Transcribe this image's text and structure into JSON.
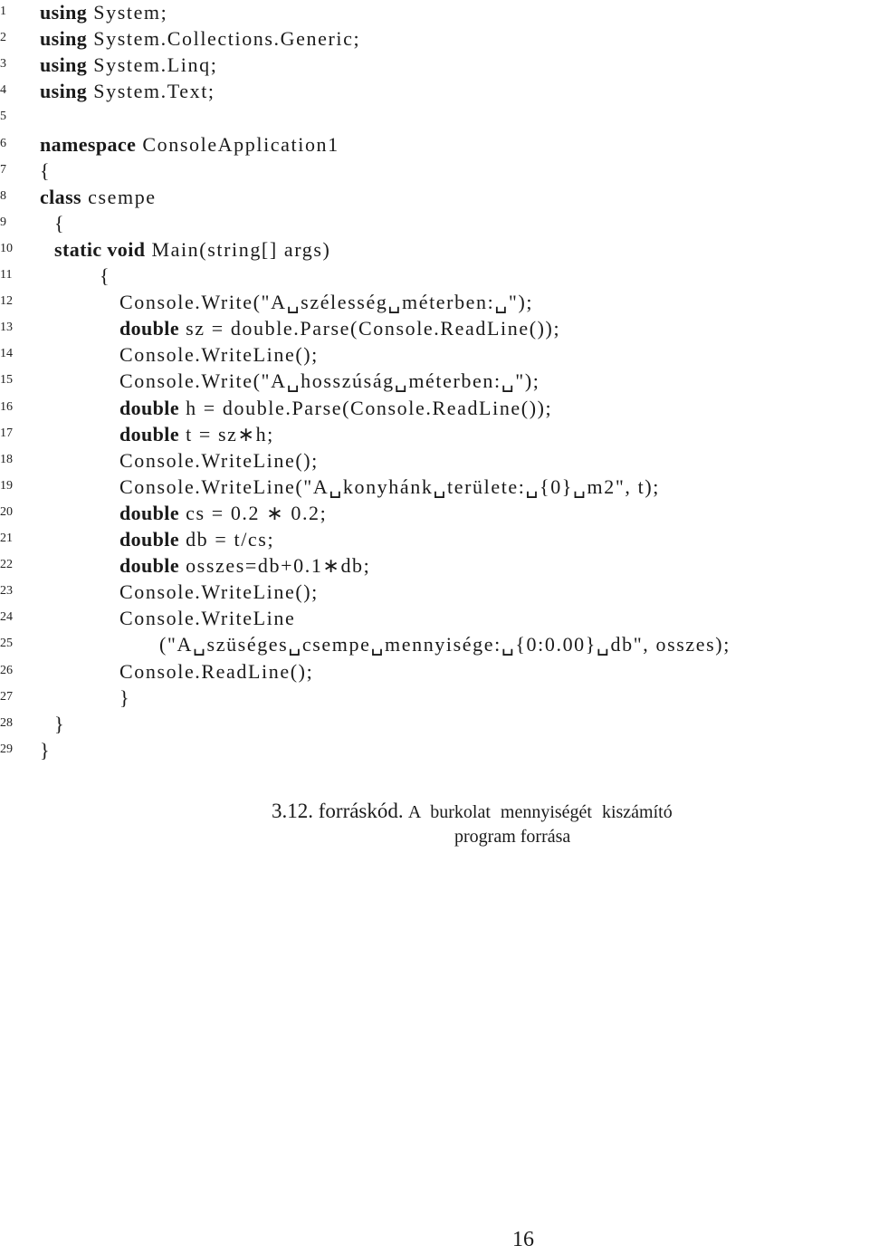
{
  "listing": {
    "lines": [
      {
        "n": "1",
        "indent": 0,
        "kw": "using",
        "rest": " System;"
      },
      {
        "n": "2",
        "indent": 0,
        "kw": "using",
        "rest": " System.Collections.Generic;"
      },
      {
        "n": "3",
        "indent": 0,
        "kw": "using",
        "rest": " System.Linq;"
      },
      {
        "n": "4",
        "indent": 0,
        "kw": "using",
        "rest": " System.Text;"
      },
      {
        "n": "5",
        "indent": 0,
        "kw": "",
        "rest": ""
      },
      {
        "n": "6",
        "indent": 0,
        "kw": "namespace",
        "rest": " ConsoleApplication1"
      },
      {
        "n": "7",
        "indent": 0,
        "kw": "",
        "rest": "{"
      },
      {
        "n": "8",
        "indent": 0,
        "kw": "class",
        "rest": " csempe"
      },
      {
        "n": "9",
        "indent": 1,
        "kw": "",
        "rest": "{"
      },
      {
        "n": "10",
        "indent": 1,
        "kw": "static void",
        "rest": " Main(string[] args)"
      },
      {
        "n": "11",
        "indent": 2,
        "kw": "",
        "rest": "{"
      },
      {
        "n": "12",
        "indent": 3,
        "kw": "",
        "rest": "Console.Write(\"A␣szélesség␣méterben:␣\");"
      },
      {
        "n": "13",
        "indent": 3,
        "kw": "double",
        "rest": " sz = double.Parse(Console.ReadLine());"
      },
      {
        "n": "14",
        "indent": 3,
        "kw": "",
        "rest": "Console.WriteLine();"
      },
      {
        "n": "15",
        "indent": 3,
        "kw": "",
        "rest": "Console.Write(\"A␣hosszúság␣méterben:␣\");"
      },
      {
        "n": "16",
        "indent": 3,
        "kw": "double",
        "rest": " h = double.Parse(Console.ReadLine());"
      },
      {
        "n": "17",
        "indent": 3,
        "kw": "double",
        "rest": " t = sz∗h;"
      },
      {
        "n": "18",
        "indent": 3,
        "kw": "",
        "rest": "Console.WriteLine();"
      },
      {
        "n": "19",
        "indent": 3,
        "kw": "",
        "rest": "Console.WriteLine(\"A␣konyhánk␣területe:␣{0}␣m2\", t);"
      },
      {
        "n": "20",
        "indent": 3,
        "kw": "double",
        "rest": " cs = 0.2 ∗ 0.2;"
      },
      {
        "n": "21",
        "indent": 3,
        "kw": "double",
        "rest": " db = t/cs;"
      },
      {
        "n": "22",
        "indent": 3,
        "kw": "double",
        "rest": " osszes=db+0.1∗db;"
      },
      {
        "n": "23",
        "indent": 3,
        "kw": "",
        "rest": "Console.WriteLine();"
      },
      {
        "n": "24",
        "indent": 3,
        "kw": "",
        "rest": "Console.WriteLine"
      },
      {
        "n": "25",
        "indent": 4,
        "kw": "",
        "rest": "(\"A␣szüséges␣csempe␣mennyisége:␣{0:0.00}␣db\", osszes);"
      },
      {
        "n": "26",
        "indent": 3,
        "kw": "",
        "rest": "Console.ReadLine();"
      },
      {
        "n": "27",
        "indent": 3,
        "kw": "",
        "rest": "}"
      },
      {
        "n": "28",
        "indent": 1,
        "kw": "",
        "rest": "}"
      },
      {
        "n": "29",
        "indent": 0,
        "kw": "",
        "rest": "}"
      }
    ]
  },
  "caption": {
    "label": "3.12. forráskód.",
    "text_line1": "A burkolat mennyiségét kiszámító",
    "text_line2": "program forrása"
  },
  "page_number": "16"
}
